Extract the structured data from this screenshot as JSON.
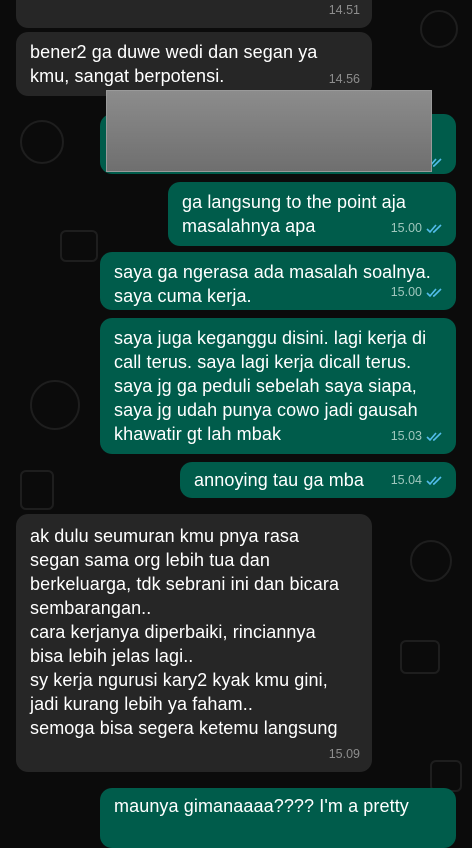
{
  "colors": {
    "incoming_bubble": "#262626",
    "outgoing_bubble": "#005c4b",
    "read_tick": "#53bdeb",
    "background": "#0b0b0b"
  },
  "messages": [
    {
      "direction": "incoming",
      "text": "",
      "time": "14.51"
    },
    {
      "direction": "incoming",
      "text": "bener2 ga duwe wedi dan segan ya\nkmu, sangat berpotensi.",
      "time": "14.56"
    },
    {
      "direction": "outgoing",
      "text": "",
      "time": "",
      "redacted": true,
      "status": "read"
    },
    {
      "direction": "outgoing",
      "text": "ga langsung to the point aja\nmasalahnya apa",
      "time": "15.00",
      "status": "read"
    },
    {
      "direction": "outgoing",
      "text": "saya ga ngerasa ada masalah soalnya.\nsaya cuma kerja.",
      "time": "15.00",
      "status": "read"
    },
    {
      "direction": "outgoing",
      "text": "saya juga keganggu disini. lagi kerja di\ncall terus.  saya lagi kerja dicall terus.\nsaya jg ga peduli sebelah saya siapa,\nsaya jg udah punya cowo jadi gausah\nkhawatir gt lah mbak",
      "time": "15.03",
      "status": "read"
    },
    {
      "direction": "outgoing",
      "text": "annoying tau ga mba",
      "time": "15.04",
      "status": "read"
    },
    {
      "direction": "incoming",
      "text": "ak dulu seumuran kmu pnya rasa\nsegan sama org lebih tua dan\nberkeluarga, tdk sebrani ini dan bicara\nsembarangan..\ncara kerjanya diperbaiki, rinciannya\nbisa lebih jelas lagi..\nsy kerja ngurusi kary2 kyak kmu gini,\njadi kurang lebih ya faham..\nsemoga bisa segera ketemu langsung",
      "time": "15.09"
    },
    {
      "direction": "outgoing",
      "text": "maunya gimanaaaa???? I'm a pretty",
      "time": "",
      "status": "read"
    }
  ]
}
